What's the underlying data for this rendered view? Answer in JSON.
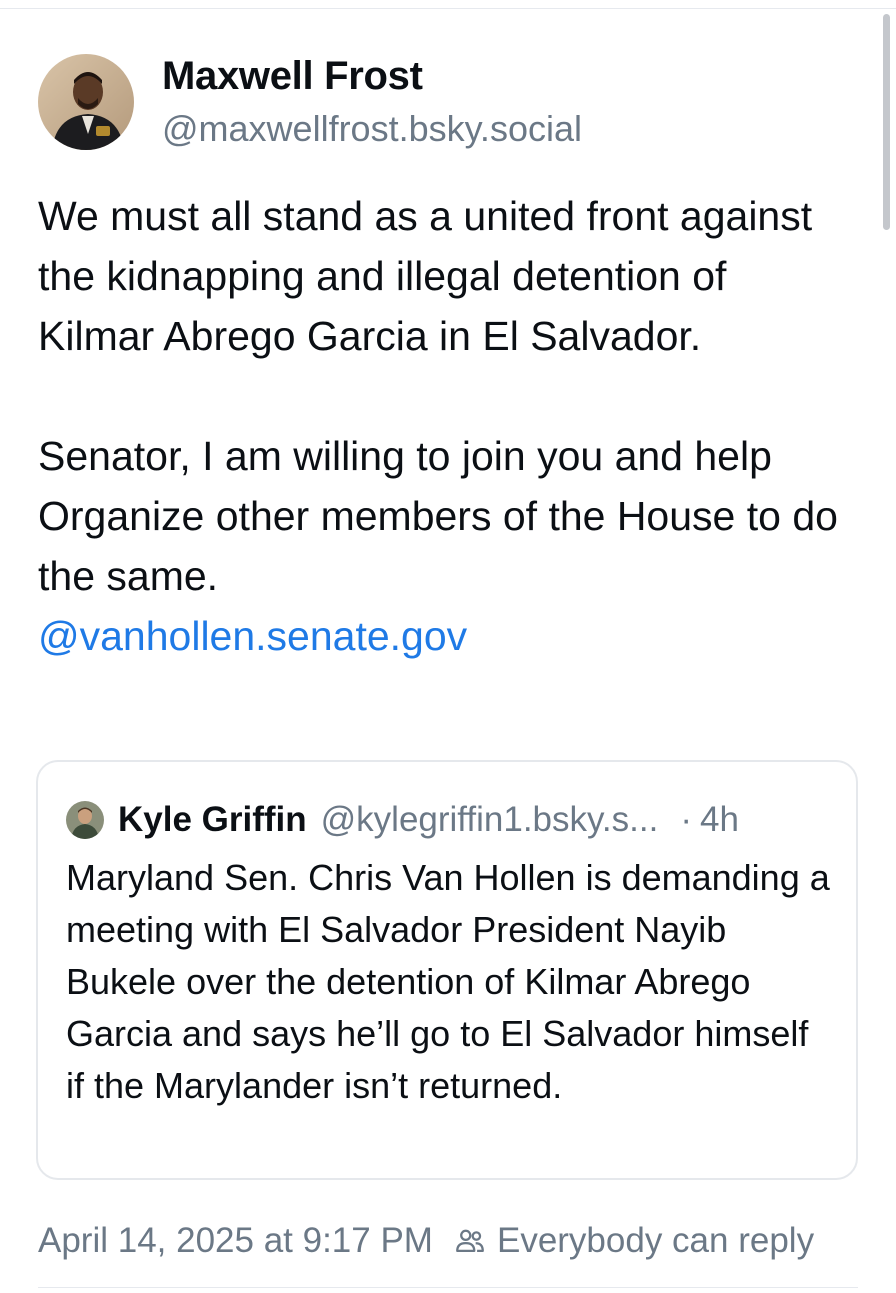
{
  "post": {
    "author": {
      "display_name": "Maxwell Frost",
      "handle": "@maxwellfrost.bsky.social",
      "avatar_icon": "person-avatar"
    },
    "paragraphs": [
      "We must all stand as a united front against the kidnapping and illegal detention of Kilmar Abrego Garcia in El Salvador.",
      "Senator, I am willing to join you and help Organize other members of the House to do the same."
    ],
    "mention": "@vanhollen.senate.gov",
    "timestamp": "April 14, 2025 at 9:17 PM",
    "reply_setting": {
      "label": "Everybody can reply",
      "icon": "people-icon"
    }
  },
  "quote": {
    "author": {
      "display_name": "Kyle Griffin",
      "handle": "@kylegriffin1.bsky.s...",
      "avatar_icon": "person-avatar"
    },
    "separator": "·",
    "time_ago": "4h",
    "text": "Maryland Sen. Chris Van Hollen is demanding a meeting with El Salvador President Nayib Bukele over the detention of Kilmar Abrego Garcia and says he’ll go to El Salvador himself if the Marylander isn’t returned."
  },
  "colors": {
    "text": "#0b0f14",
    "muted": "#6b7886",
    "link": "#1f7ae6",
    "border": "#e5e8ec"
  }
}
